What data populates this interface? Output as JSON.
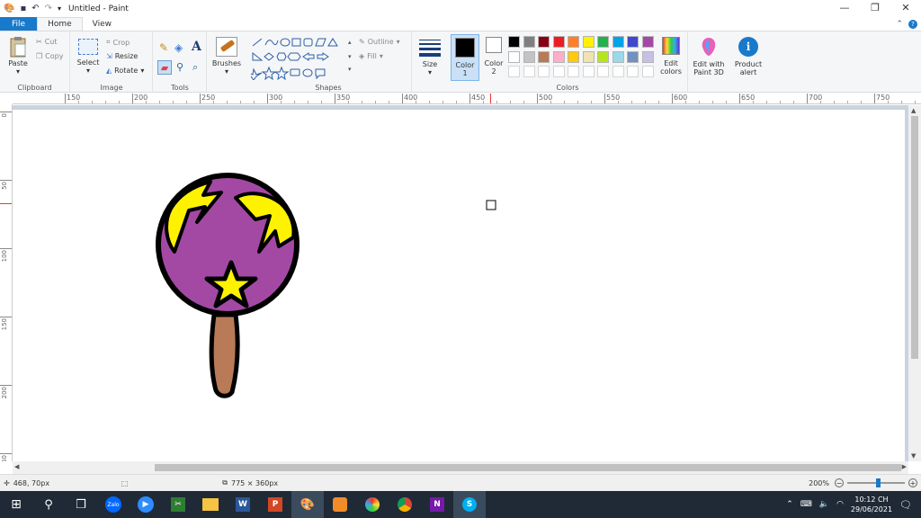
{
  "window": {
    "title": "Untitled - Paint",
    "controls": [
      "—",
      "❐",
      "✕"
    ]
  },
  "tabs": {
    "file": "File",
    "home": "Home",
    "view": "View"
  },
  "ribbon": {
    "clipboard": {
      "label": "Clipboard",
      "paste": "Paste",
      "cut": "Cut",
      "copy": "Copy"
    },
    "image": {
      "label": "Image",
      "select": "Select",
      "crop": "Crop",
      "resize": "Resize",
      "rotate": "Rotate"
    },
    "tools": {
      "label": "Tools"
    },
    "brushes": {
      "label": "Brushes"
    },
    "shapes": {
      "label": "Shapes",
      "outline": "Outline",
      "fill": "Fill"
    },
    "size": {
      "label": "Size"
    },
    "colors": {
      "label": "Colors",
      "color1": "Color\n1",
      "color1_line1": "Color",
      "color1_line2": "1",
      "color2_line1": "Color",
      "color2_line2": "2",
      "edit_colors_line1": "Edit",
      "edit_colors_line2": "colors",
      "palette_row1": [
        "#000000",
        "#7f7f7f",
        "#880015",
        "#ed1c24",
        "#ff7f27",
        "#fff200",
        "#22b14c",
        "#00a2e8",
        "#3f48cc",
        "#a349a4"
      ],
      "palette_row2": [
        "#ffffff",
        "#c3c3c3",
        "#b97a57",
        "#ffaec9",
        "#ffc90e",
        "#efe4b0",
        "#b5e61d",
        "#99d9ea",
        "#7092be",
        "#c8bfe7"
      ]
    },
    "paint3d": {
      "line1": "Edit with",
      "line2": "Paint 3D"
    },
    "product_alert": {
      "line1": "Product",
      "line2": "alert"
    }
  },
  "ruler": {
    "h_labels": [
      "150",
      "200",
      "250",
      "300",
      "350",
      "400",
      "450",
      "500",
      "550",
      "600",
      "650",
      "700",
      "750"
    ],
    "v_labels": [
      "0",
      "50",
      "100",
      "150",
      "200",
      "250"
    ]
  },
  "status": {
    "cursor_pos": "468, 70px",
    "canvas_size": "775 × 360px",
    "zoom": "200%"
  },
  "taskbar": {
    "time": "10:12 CH",
    "date": "29/06/2021"
  },
  "colors": {
    "accent": "#1979ca",
    "lollipop_fill": "#a349a4",
    "bolt_fill": "#fff200",
    "stick_fill": "#b97a57"
  }
}
